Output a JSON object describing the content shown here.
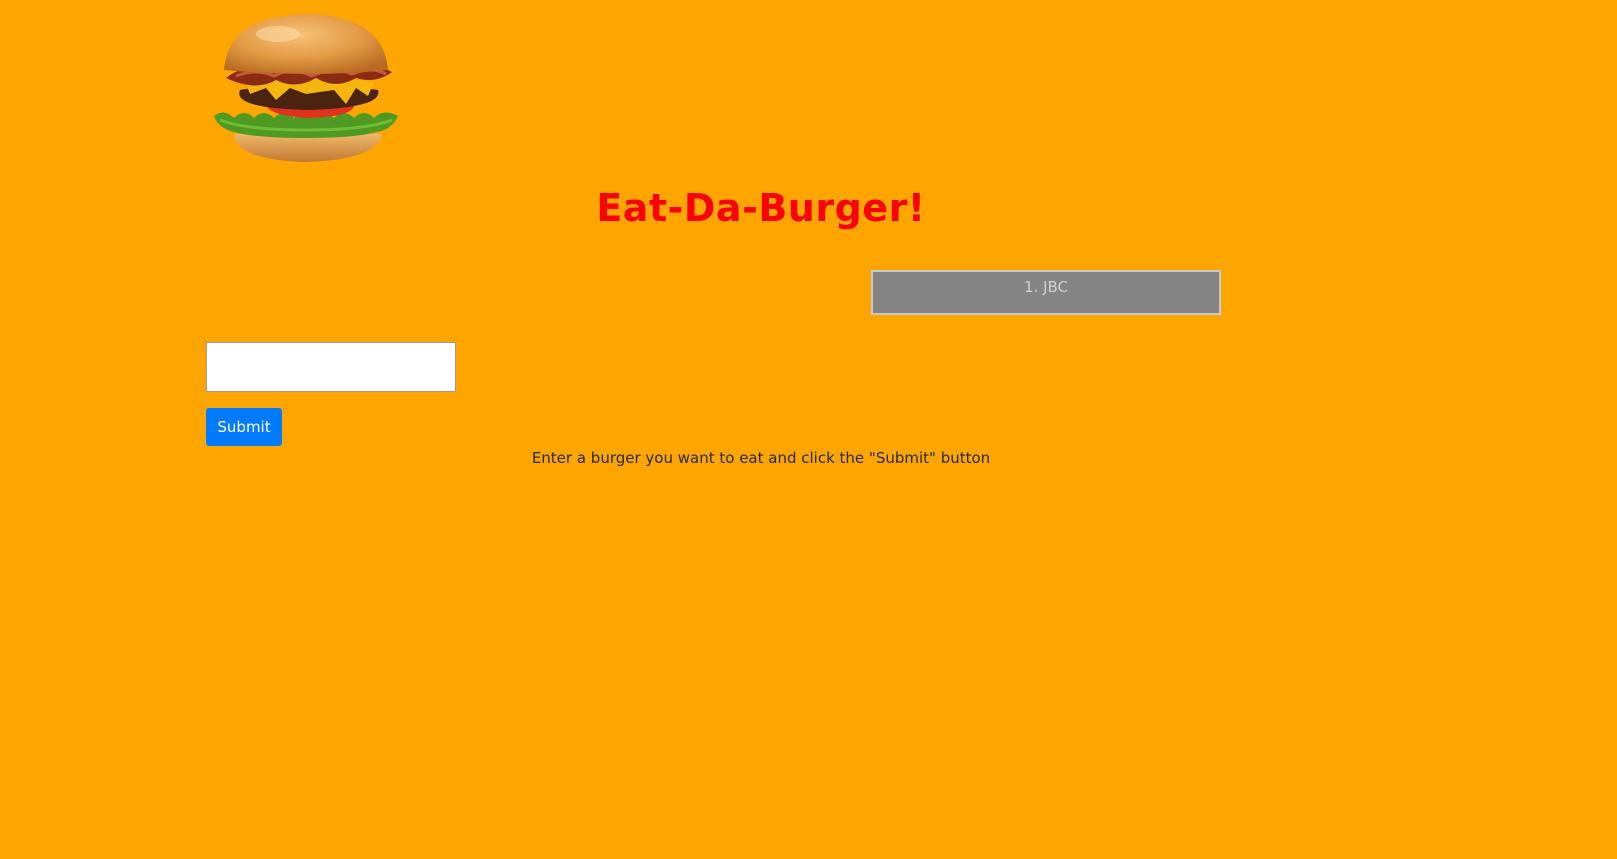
{
  "header": {
    "logo_name": "burger-logo",
    "title": "Eat-Da-Burger!"
  },
  "burgers": [
    {
      "label": "1. JBC"
    }
  ],
  "form": {
    "input_value": "",
    "input_placeholder": "",
    "submit_label": "Submit"
  },
  "instructions": "Enter a burger you want to eat and click the \"Submit\" button",
  "colors": {
    "background": "#ffa500",
    "title": "#ff0000",
    "list_item_bg": "#848484",
    "button": "#007bff"
  }
}
